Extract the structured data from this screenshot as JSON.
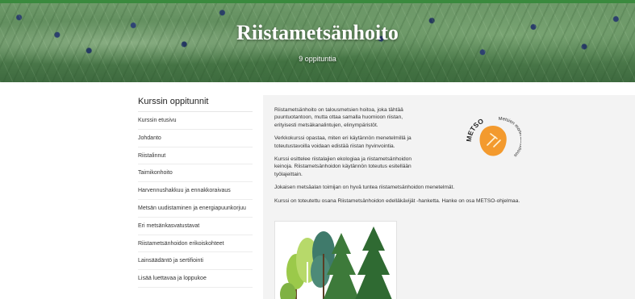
{
  "hero": {
    "title": "Riistametsänhoito",
    "subtitle": "9 oppituntia"
  },
  "sidebar": {
    "title": "Kurssin oppitunnit",
    "items": [
      {
        "label": "Kurssin etusivu"
      },
      {
        "label": "Johdanto"
      },
      {
        "label": "Riistalinnut"
      },
      {
        "label": "Taimikonhoito"
      },
      {
        "label": "Harvennushakkuu ja ennakkoraivaus"
      },
      {
        "label": "Metsän uudistaminen ja energiapuunkorjuu"
      },
      {
        "label": "Eri metsänkasvatustavat"
      },
      {
        "label": "Riistametsänhoidon erikoiskohteet"
      },
      {
        "label": "Lainsäädäntö ja sertifiointi"
      },
      {
        "label": "Lisää luettavaa ja loppukoe"
      }
    ]
  },
  "content": {
    "p1": "Riistametsänhoito on talousmetsien hoitoa, joka tähtää puuntuotantoon, mutta ottaa samalla huomioon riistan, erityisesti metsäkanalintujen, elinympäristöt.",
    "p2": "Verkkokurssi opastaa, miten eri käytännön menetelmillä ja toteutustavoilla voidaan edistää riistan hyvinvointia.",
    "p3": "Kurssi esittelee riistalajien ekologiaa ja riistametsänhoidon keinoja. Riistametsänhoidon käytännön toteutus esitellään työlajeittain.",
    "p4": "Jokaisen metsäalan toimijan on hyvä tuntea riistametsänhoidon menetelmät.",
    "p5": "Kurssi on toteutettu osana Riistametsänhoidon edelläkävijät -hanketta. Hanke on osa METSO-ohjelmaa."
  },
  "logo": {
    "top_text": "METSO",
    "bottom_text": "Metsien monimuotoisuus"
  },
  "colors": {
    "accent_green": "#3a8a3e",
    "metso_orange": "#f39a2e",
    "content_bg": "#f3f3f3"
  }
}
